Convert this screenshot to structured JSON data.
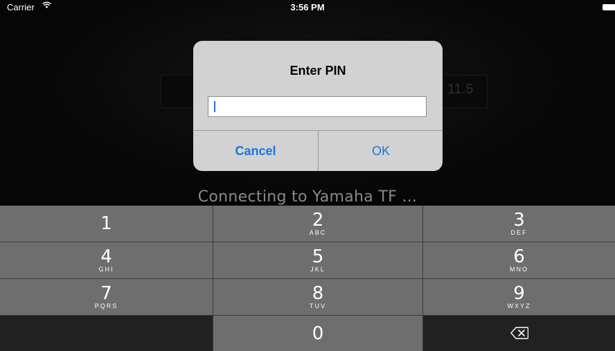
{
  "status_bar": {
    "carrier": "Carrier",
    "wifi_icon": "wifi-icon",
    "time": "3:56 PM",
    "battery_icon": "battery-icon"
  },
  "background": {
    "ghost_value": "11.5",
    "connecting_text": "Connecting to Yamaha TF ..."
  },
  "dialog": {
    "title": "Enter PIN",
    "input_value": "",
    "cancel_label": "Cancel",
    "ok_label": "OK",
    "accent_color": "#1a75e0"
  },
  "keypad": {
    "keys": [
      {
        "digit": "1",
        "letters": ""
      },
      {
        "digit": "2",
        "letters": "ABC"
      },
      {
        "digit": "3",
        "letters": "DEF"
      },
      {
        "digit": "4",
        "letters": "GHI"
      },
      {
        "digit": "5",
        "letters": "JKL"
      },
      {
        "digit": "6",
        "letters": "MNO"
      },
      {
        "digit": "7",
        "letters": "PQRS"
      },
      {
        "digit": "8",
        "letters": "TUV"
      },
      {
        "digit": "9",
        "letters": "WXYZ"
      },
      {
        "digit": "0",
        "letters": ""
      }
    ],
    "delete_icon": "backspace-icon"
  }
}
